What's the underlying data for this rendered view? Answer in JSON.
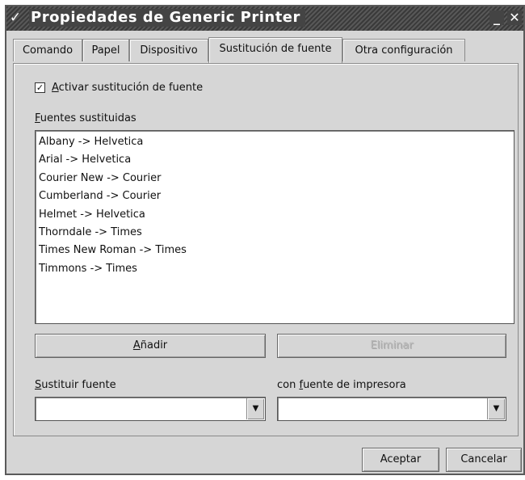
{
  "window": {
    "title": "Propiedades de Generic Printer",
    "menu_glyph": "✓",
    "minimize_glyph": "_",
    "close_glyph": "✕"
  },
  "tabs": [
    {
      "label": "Comando"
    },
    {
      "label": "Papel"
    },
    {
      "label": "Dispositivo"
    },
    {
      "label": "Sustitución de fuente",
      "active": true
    },
    {
      "label": "Otra configuración"
    }
  ],
  "substitution": {
    "checkbox_mark": "✓",
    "checkbox_checked": true,
    "checkbox_label_first": "A",
    "checkbox_label_rest": "ctivar sustitución de fuente",
    "list_label_first": "F",
    "list_label_rest": "uentes sustituidas",
    "items": [
      "Albany -> Helvetica",
      "Arial -> Helvetica",
      "Courier New -> Courier",
      "Cumberland -> Courier",
      "Helmet -> Helvetica",
      "Thorndale -> Times",
      "Times New Roman -> Times",
      "Timmons -> Times"
    ],
    "add_label_first": "A",
    "add_label_rest": "ñadir",
    "remove_label": "Eliminar",
    "replace_label_first": "S",
    "replace_label_rest": "ustituir fuente",
    "printer_font_label_before": "con ",
    "printer_font_label_u": "f",
    "printer_font_label_after": "uente de impresora",
    "replace_value": "",
    "printer_font_value": "",
    "dropdown_glyph": "▼"
  },
  "footer": {
    "ok_label": "Aceptar",
    "cancel_label": "Cancelar"
  }
}
